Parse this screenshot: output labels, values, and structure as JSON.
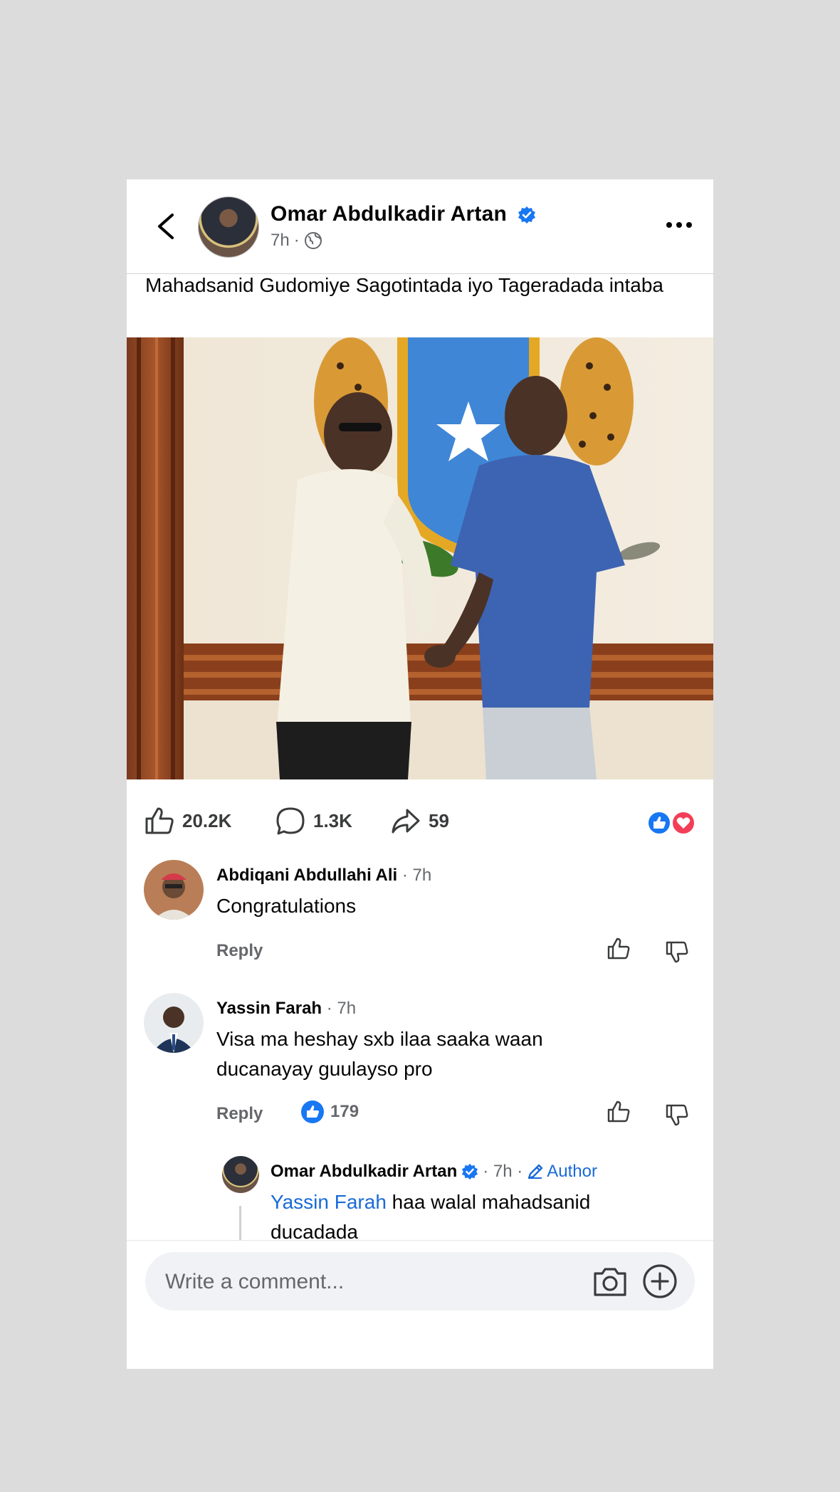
{
  "post": {
    "author": "Omar Abdulkadir Artan",
    "time": "7h",
    "separator": "·",
    "caption": "Mahadsanid Gudomiye Sagotintada iyo Tageradada intaba"
  },
  "stats": {
    "likes": "20.2K",
    "comments": "1.3K",
    "shares": "59"
  },
  "comments": [
    {
      "name": "Abdiqani Abdullahi Ali",
      "time": "· 7h",
      "text": "Congratulations",
      "reply_label": "Reply"
    },
    {
      "name": "Yassin Farah",
      "time": "· 7h",
      "text": "Visa ma heshay sxb ilaa saaka waan ducanayay guulayso pro",
      "reply_label": "Reply",
      "likes": "179"
    }
  ],
  "reply": {
    "name": "Omar Abdulkadir Artan",
    "time": "· 7h ·",
    "badge": "Author",
    "mention": "Yassin Farah",
    "text": " haa walal mahadsanid ducadada"
  },
  "composer": {
    "placeholder": "Write a comment..."
  },
  "colors": {
    "accent": "#1a6ad8",
    "verified": "#1877f2",
    "love": "#f33e58"
  },
  "icons": [
    "back-arrow-icon",
    "verified-badge-icon",
    "globe-icon",
    "more-icon",
    "like-icon",
    "comment-icon",
    "share-icon",
    "reaction-like-icon",
    "reaction-love-icon",
    "thumbs-up-icon",
    "thumbs-down-icon",
    "edit-pen-icon",
    "camera-icon",
    "plus-circle-icon"
  ]
}
